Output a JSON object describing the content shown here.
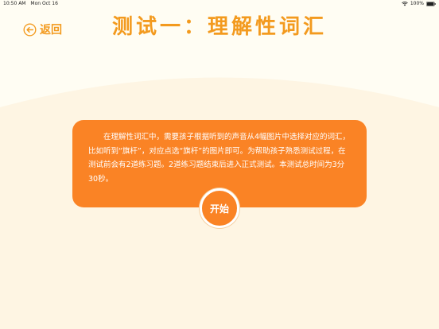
{
  "status_bar": {
    "time": "10:50 AM",
    "date": "Mon Oct 16",
    "battery": "100%",
    "icons": [
      "wifi-icon",
      "battery-icon"
    ]
  },
  "header": {
    "back_label": "返回",
    "back_icon": "arrow-left-circle-icon",
    "title": "测试一：理解性词汇"
  },
  "card": {
    "text": "在理解性词汇中，需要孩子根据听到的声音从4幅图片中选择对应的词汇，比如听到“旗杆”，对应点选“旗杆”的图片即可。为帮助孩子熟悉测试过程，在测试前会有2道练习题。2道练习题结束后进入正式测试。本测试总时间为3分30秒。"
  },
  "start_button": {
    "label": "开始"
  },
  "colors": {
    "accent": "#F39A1E",
    "card": "#FA8325",
    "background": "#FEF5E3",
    "header_background": "#FFFDF3"
  }
}
